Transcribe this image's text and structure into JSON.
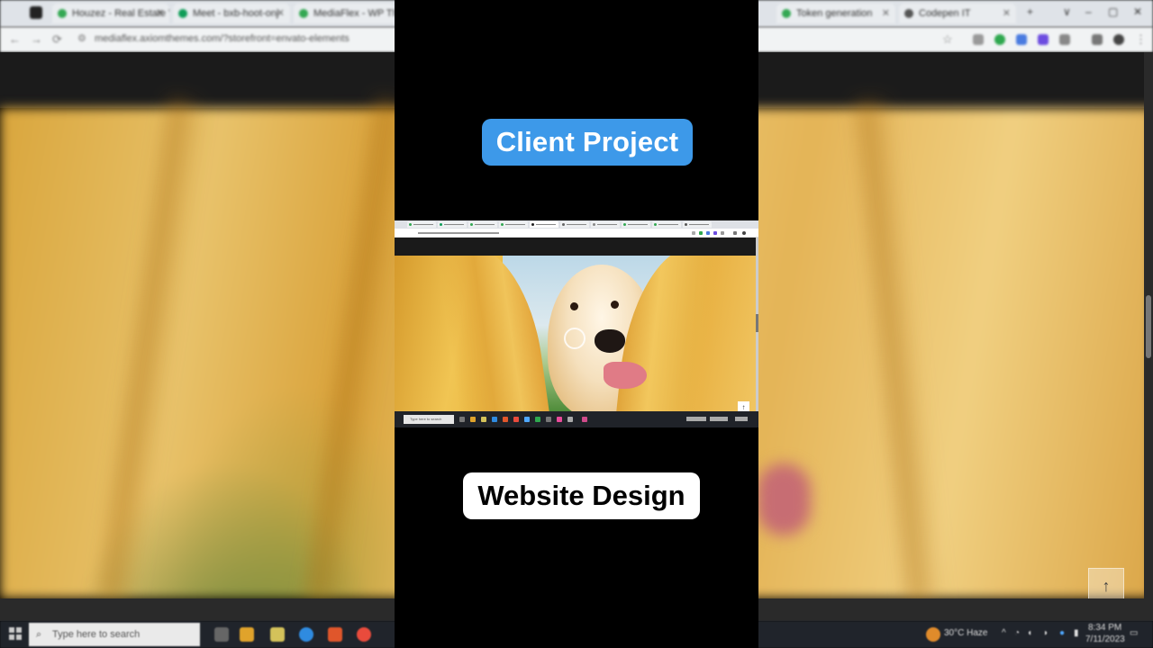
{
  "overlay": {
    "title": "Client Project",
    "subtitle": "Website Design"
  },
  "browser": {
    "tabs": [
      {
        "label": "Houzez - Real Estate W...",
        "color": "#34a853"
      },
      {
        "label": "Meet - bxb-hoot-onj",
        "color": "#0f9d58"
      },
      {
        "label": "MediaFlex - WP Theme",
        "color": "#34a853"
      },
      {
        "label": "Token generation",
        "color": "#34a853"
      },
      {
        "label": "Codepen IT",
        "color": "#555555"
      }
    ],
    "url": "mediaflex.axiomthemes.com/?storefront=envato-elements",
    "window_controls": [
      "∨",
      "–",
      "▢",
      "✕"
    ]
  },
  "taskbar": {
    "search_placeholder": "Type here to search",
    "weather": "30°C  Haze",
    "time": "8:34 PM",
    "date": "7/11/2023"
  },
  "mini_screen": {
    "search_placeholder": "Type here to search",
    "scroll_top_label": "↑"
  },
  "scroll_top_label": "↑",
  "icons": {
    "search": "magnifier-icon",
    "windows": "windows-start-icon",
    "scroll_top": "arrow-up-icon"
  },
  "colors": {
    "title_pill": "#3d99e9",
    "subtitle_pill": "#ffffff"
  }
}
